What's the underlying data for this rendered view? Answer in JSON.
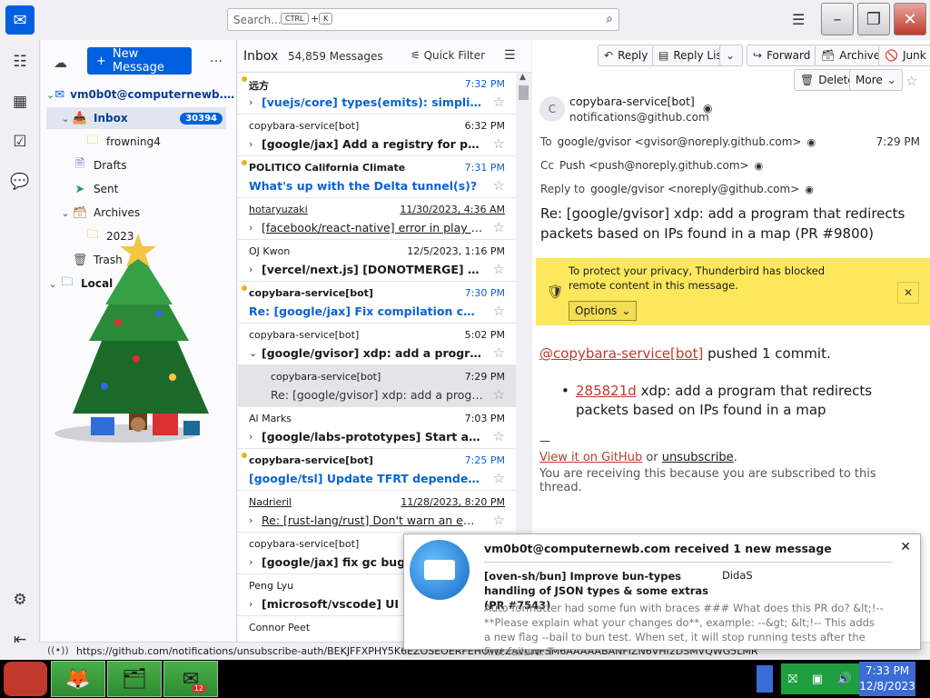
{
  "search": {
    "placeholder": "Search...",
    "key1": "CTRL",
    "key2": "K"
  },
  "folder_pane": {
    "new_message": "New Message",
    "items": [
      {
        "label": "vm0b0t@computernewb.…",
        "level": 0,
        "twisty": "v",
        "icon": "mail-account",
        "bold": true
      },
      {
        "label": "Inbox",
        "level": 1,
        "twisty": "v",
        "icon": "inbox",
        "badge": "30394",
        "selected": true
      },
      {
        "label": "frowning4",
        "level": 2,
        "twisty": "",
        "icon": "folder"
      },
      {
        "label": "Drafts",
        "level": 1,
        "twisty": "",
        "icon": "drafts"
      },
      {
        "label": "Sent",
        "level": 1,
        "twisty": "",
        "icon": "sent"
      },
      {
        "label": "Archives",
        "level": 1,
        "twisty": "v",
        "icon": "archive"
      },
      {
        "label": "2023",
        "level": 2,
        "twisty": "",
        "icon": "folder"
      },
      {
        "label": "Trash",
        "level": 1,
        "twisty": "",
        "icon": "trash"
      },
      {
        "label": "Local",
        "level": 0,
        "twisty": "v",
        "icon": "local-folder",
        "bold": true
      }
    ]
  },
  "thread_pane": {
    "folder": "Inbox",
    "count": "54,859 Messages",
    "quick_filter": "Quick Filter",
    "messages": [
      {
        "sender": "远方",
        "date": "7:32 PM",
        "subject": "[vuejs/core] types(emits): simplify ty…",
        "state": "unread",
        "twisty": true
      },
      {
        "sender": "copybara-service[bot]",
        "date": "6:32 PM",
        "subject": "[google/jax] Add a registry for primi…",
        "state": "normal",
        "twisty": true
      },
      {
        "sender": "POLITICO California Climate",
        "date": "7:31 PM",
        "subject": "What's up with the Delta tunnel(s)?",
        "state": "unread",
        "twisty": false
      },
      {
        "sender": "hotaryuzaki",
        "date": "11/30/2023, 4:36 AM",
        "subject": "[facebook/react-native] error in play sto…",
        "state": "read",
        "twisty": true
      },
      {
        "sender": "OJ Kwon",
        "date": "12/5/2023, 1:16 PM",
        "subject": "[vercel/next.js] [DONOTMERGE] refac…",
        "state": "normal",
        "twisty": true
      },
      {
        "sender": "copybara-service[bot]",
        "date": "7:30 PM",
        "subject": "Re: [google/jax] Fix compilation cache t…",
        "state": "unread",
        "twisty": false
      },
      {
        "sender": "copybara-service[bot]",
        "date": "5:02 PM",
        "subject": "[google/gvisor] xdp: add a program t…",
        "state": "normal",
        "twisty": true,
        "expanded": true
      },
      {
        "sender": "copybara-service[bot]",
        "date": "7:29 PM",
        "subject": "Re: [google/gvisor] xdp: add a progra…",
        "state": "child",
        "twisty": false,
        "selected": true
      },
      {
        "sender": "Al Marks",
        "date": "7:03 PM",
        "subject": "[google/labs-prototypes] Start a doc…",
        "state": "normal",
        "twisty": true
      },
      {
        "sender": "copybara-service[bot]",
        "date": "7:25 PM",
        "subject": "[google/tsl] Update TFRT dependency t…",
        "state": "unread",
        "twisty": false
      },
      {
        "sender": "Nadrieril",
        "date": "11/28/2023, 8:20 PM",
        "subject": "Re: [rust-lang/rust] Don't warn an empty…",
        "state": "read",
        "twisty": true
      },
      {
        "sender": "copybara-service[bot]",
        "date": "",
        "subject": "[google/jax] fix gc bug in",
        "state": "normal",
        "twisty": true
      },
      {
        "sender": "Peng Lyu",
        "date": "",
        "subject": "[microsoft/vscode] UI gli",
        "state": "normal",
        "twisty": true
      },
      {
        "sender": "Connor Peet",
        "date": "",
        "subject": "",
        "state": "normal",
        "twisty": false
      }
    ]
  },
  "header_buttons": {
    "reply": "Reply",
    "reply_list": "Reply List",
    "forward": "Forward",
    "archive": "Archive",
    "junk": "Junk",
    "delete": "Delete",
    "more": "More"
  },
  "message": {
    "avatar_initial": "C",
    "from_name": "copybara-service[bot]",
    "from_addr": "notifications@github.com",
    "to_label": "To",
    "to": "google/gvisor <gvisor@noreply.github.com>",
    "time": "7:29 PM",
    "cc_label": "Cc",
    "cc": "Push <push@noreply.github.com>",
    "reply_to_label": "Reply to",
    "reply_to": "google/gvisor <noreply@github.com>",
    "subject": "Re: [google/gvisor] xdp: add a program that redirects packets based on IPs found in a map (PR #9800)",
    "privacy_text": "To protect your privacy, Thunderbird has blocked remote content in this message.",
    "privacy_options": "Options",
    "body_mention": "@copybara-service[bot]",
    "body_pushed": " pushed 1 commit.",
    "commit_hash": "285821d",
    "commit_text": " xdp: add a program that redirects packets based on IPs found in a map",
    "sig_dash": "—",
    "footer_view": "View it on GitHub",
    "footer_or": " or ",
    "footer_unsub": "unsubscribe",
    "footer_dot": ".",
    "footer_receiving": "You are receiving this because you are subscribed to this thread."
  },
  "status_bar": {
    "url": "https://github.com/notifications/unsubscribe-auth/BEKJFFXPHY5K6EZOSEOERFEHOWFZAVCNFSM6AAAAABANFIZN6VHI2DSMVQWG5LMR"
  },
  "notification": {
    "title": "vm0b0t@computernewb.com received 1 new message",
    "subject": "[oven-sh/bun] Improve bun-types handling of JSON types & some extras (PR #7543)",
    "author": "DidaS",
    "preview": "Auto formatter had some fun with braces ### What does this PR do? &lt;!-- **Please explain what your changes do**, example: --&gt; &lt;!-- This adds a new flag --bail to bun test. When set, it will stop running tests after the first failure. T"
  },
  "taskbar": {
    "thunderbird_badge": "12",
    "clock_time": "7:33 PM",
    "clock_date": "12/8/2023"
  },
  "colors": {
    "accent": "#0060df",
    "unread": "#0a62d4",
    "privacy_bar": "#fde85d",
    "link": "#c0392b",
    "taskbar_green": "#2f8a30"
  }
}
